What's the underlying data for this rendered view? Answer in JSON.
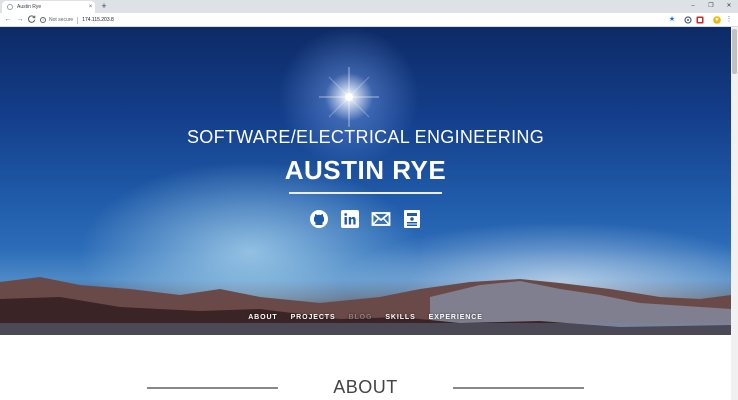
{
  "browser": {
    "tab_title": "Austin Rye",
    "tab_close": "×",
    "new_tab": "+",
    "window_minimize": "–",
    "window_restore": "❐",
    "window_close": "✕",
    "back": "←",
    "forward": "→",
    "reload": "C",
    "security_label": "Not secure",
    "url": "174.115.203.8",
    "toolbar_icons": [
      "star-icon",
      "extension-icon",
      "extension-icon",
      "profile-icon",
      "menu-icon"
    ]
  },
  "hero": {
    "subtitle": "SOFTWARE/ELECTRICAL ENGINEERING",
    "name": "AUSTIN RYE",
    "socials": [
      "github-icon",
      "linkedin-icon",
      "email-icon",
      "resume-icon"
    ]
  },
  "nav": {
    "items": [
      "ABOUT",
      "PROJECTS",
      "BLOG",
      "SKILLS",
      "EXPERIENCE"
    ]
  },
  "about": {
    "title": "ABOUT"
  },
  "colors": {
    "sky_top": "#0d2a66",
    "sky_mid": "#1f5aa8",
    "rule": "#888888"
  }
}
